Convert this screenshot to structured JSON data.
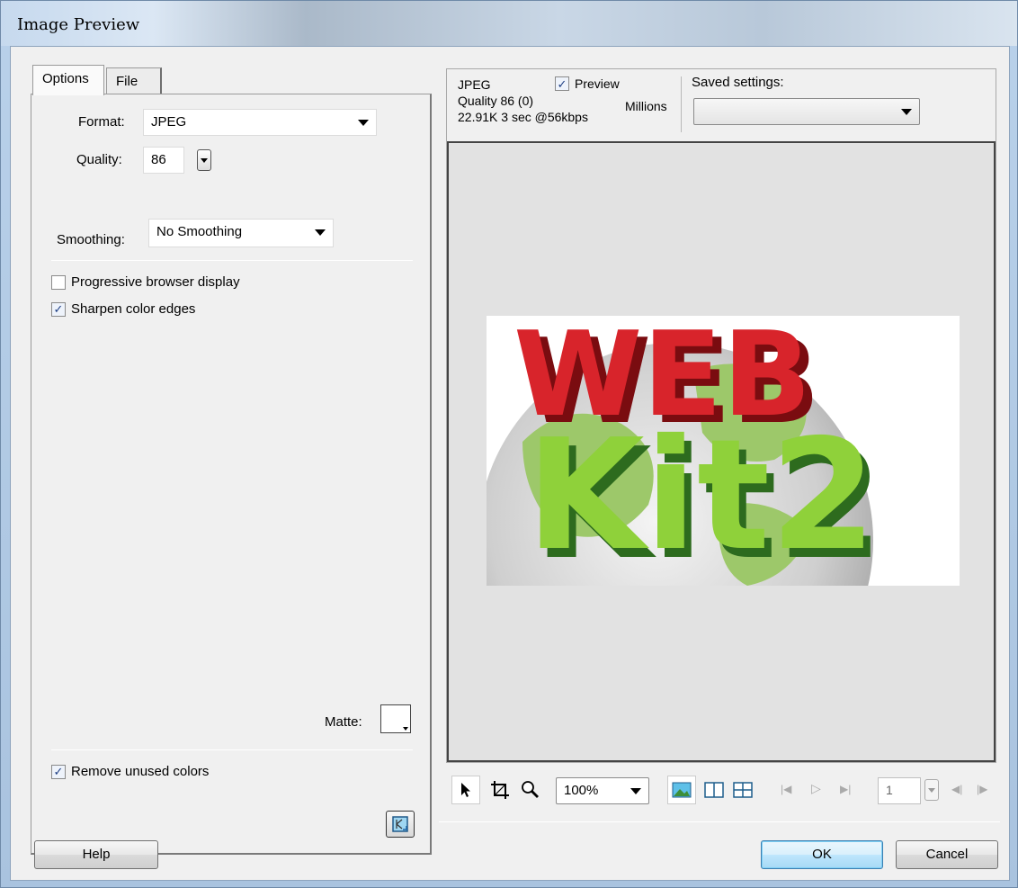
{
  "window": {
    "title": "Image Preview"
  },
  "tabs": [
    {
      "label": "Options",
      "active": true
    },
    {
      "label": "File",
      "active": false
    }
  ],
  "options": {
    "format_label": "Format:",
    "format_value": "JPEG",
    "quality_label": "Quality:",
    "quality_value": "86",
    "smoothing_label": "Smoothing:",
    "smoothing_value": "No Smoothing",
    "progressive_label": "Progressive browser display",
    "progressive_checked": false,
    "sharpen_label": "Sharpen color edges",
    "sharpen_checked": true,
    "matte_label": "Matte:",
    "matte_color": "#ffffff",
    "remove_unused_label": "Remove unused colors",
    "remove_unused_checked": true
  },
  "preview_info": {
    "format": "JPEG",
    "quality": "Quality 86 (0)",
    "size_speed": "22.91K  3 sec @56kbps",
    "preview_label": "Preview",
    "preview_checked": true,
    "colors": "Millions",
    "saved_settings_label": "Saved settings:",
    "saved_settings_value": ""
  },
  "preview_image": {
    "top_text": "WEB",
    "bottom_text": "Kit2",
    "colors": {
      "web": "#c8141c",
      "kit": "#8fd13a",
      "globe": "#9dc86a"
    }
  },
  "toolbar": {
    "tools": [
      "pointer-icon",
      "crop-icon",
      "zoom-icon"
    ],
    "zoom_value": "100%",
    "view_modes": [
      "single-view-icon",
      "two-up-view-icon",
      "four-up-view-icon"
    ],
    "frame_value": "1"
  },
  "buttons": {
    "help": "Help",
    "ok": "OK",
    "cancel": "Cancel"
  }
}
